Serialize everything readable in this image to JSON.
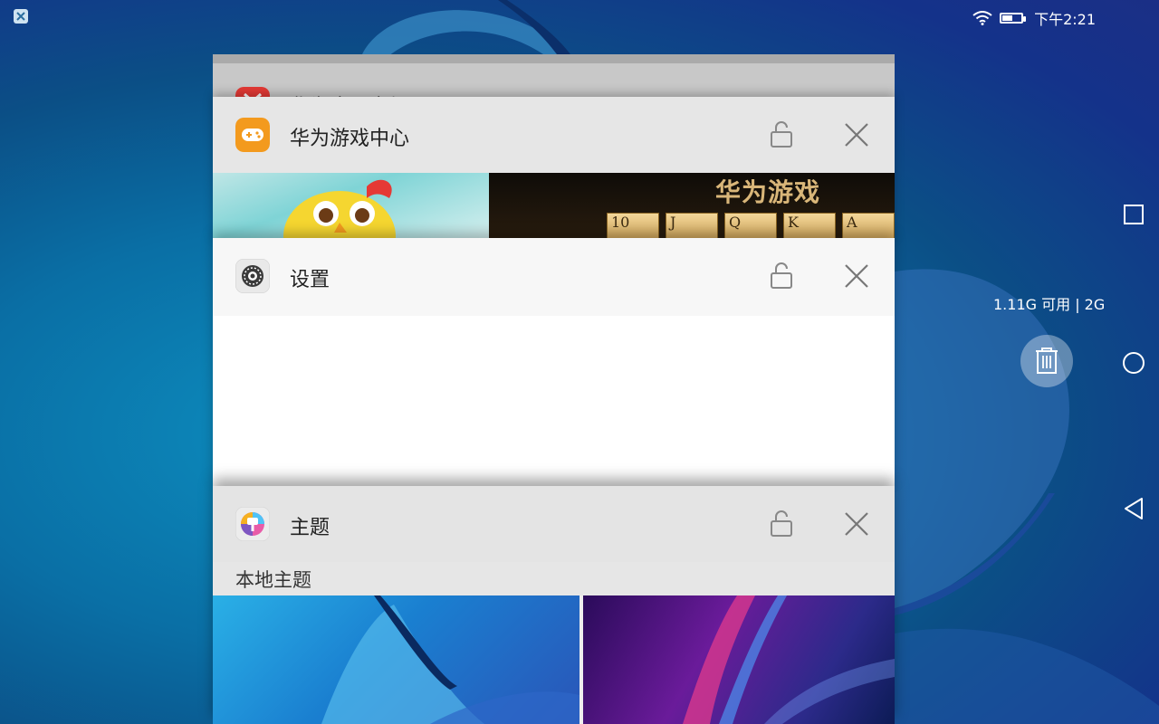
{
  "status_bar": {
    "time": "下午2:21",
    "left_icon": "notification-app-icon",
    "wifi_icon": "wifi-icon",
    "battery_level": 0.55
  },
  "recent_apps": [
    {
      "title": "华为应用市场",
      "icon": "app-market-icon",
      "lock_icon": "unlock-icon",
      "close_icon": "close-icon"
    },
    {
      "title": "华为游戏中心",
      "icon": "game-center-icon",
      "lock_icon": "unlock-icon",
      "close_icon": "close-icon",
      "preview_banner": "华为游戏",
      "preview_cards": [
        "10",
        "J",
        "Q",
        "K",
        "A"
      ]
    },
    {
      "title": "设置",
      "icon": "settings-gear-icon",
      "lock_icon": "unlock-icon",
      "close_icon": "close-icon"
    },
    {
      "title": "主题",
      "icon": "themes-brush-icon",
      "lock_icon": "unlock-icon",
      "close_icon": "close-icon",
      "section_label": "本地主题"
    }
  ],
  "memory": {
    "text": "1.11G 可用 | 2G"
  },
  "nav_bar": {
    "recents_icon": "square-icon",
    "home_icon": "circle-icon",
    "back_icon": "triangle-back-icon"
  },
  "colors": {
    "accent_orange": "#f39a1e",
    "wallpaper_blue": "#0a6fa5"
  }
}
